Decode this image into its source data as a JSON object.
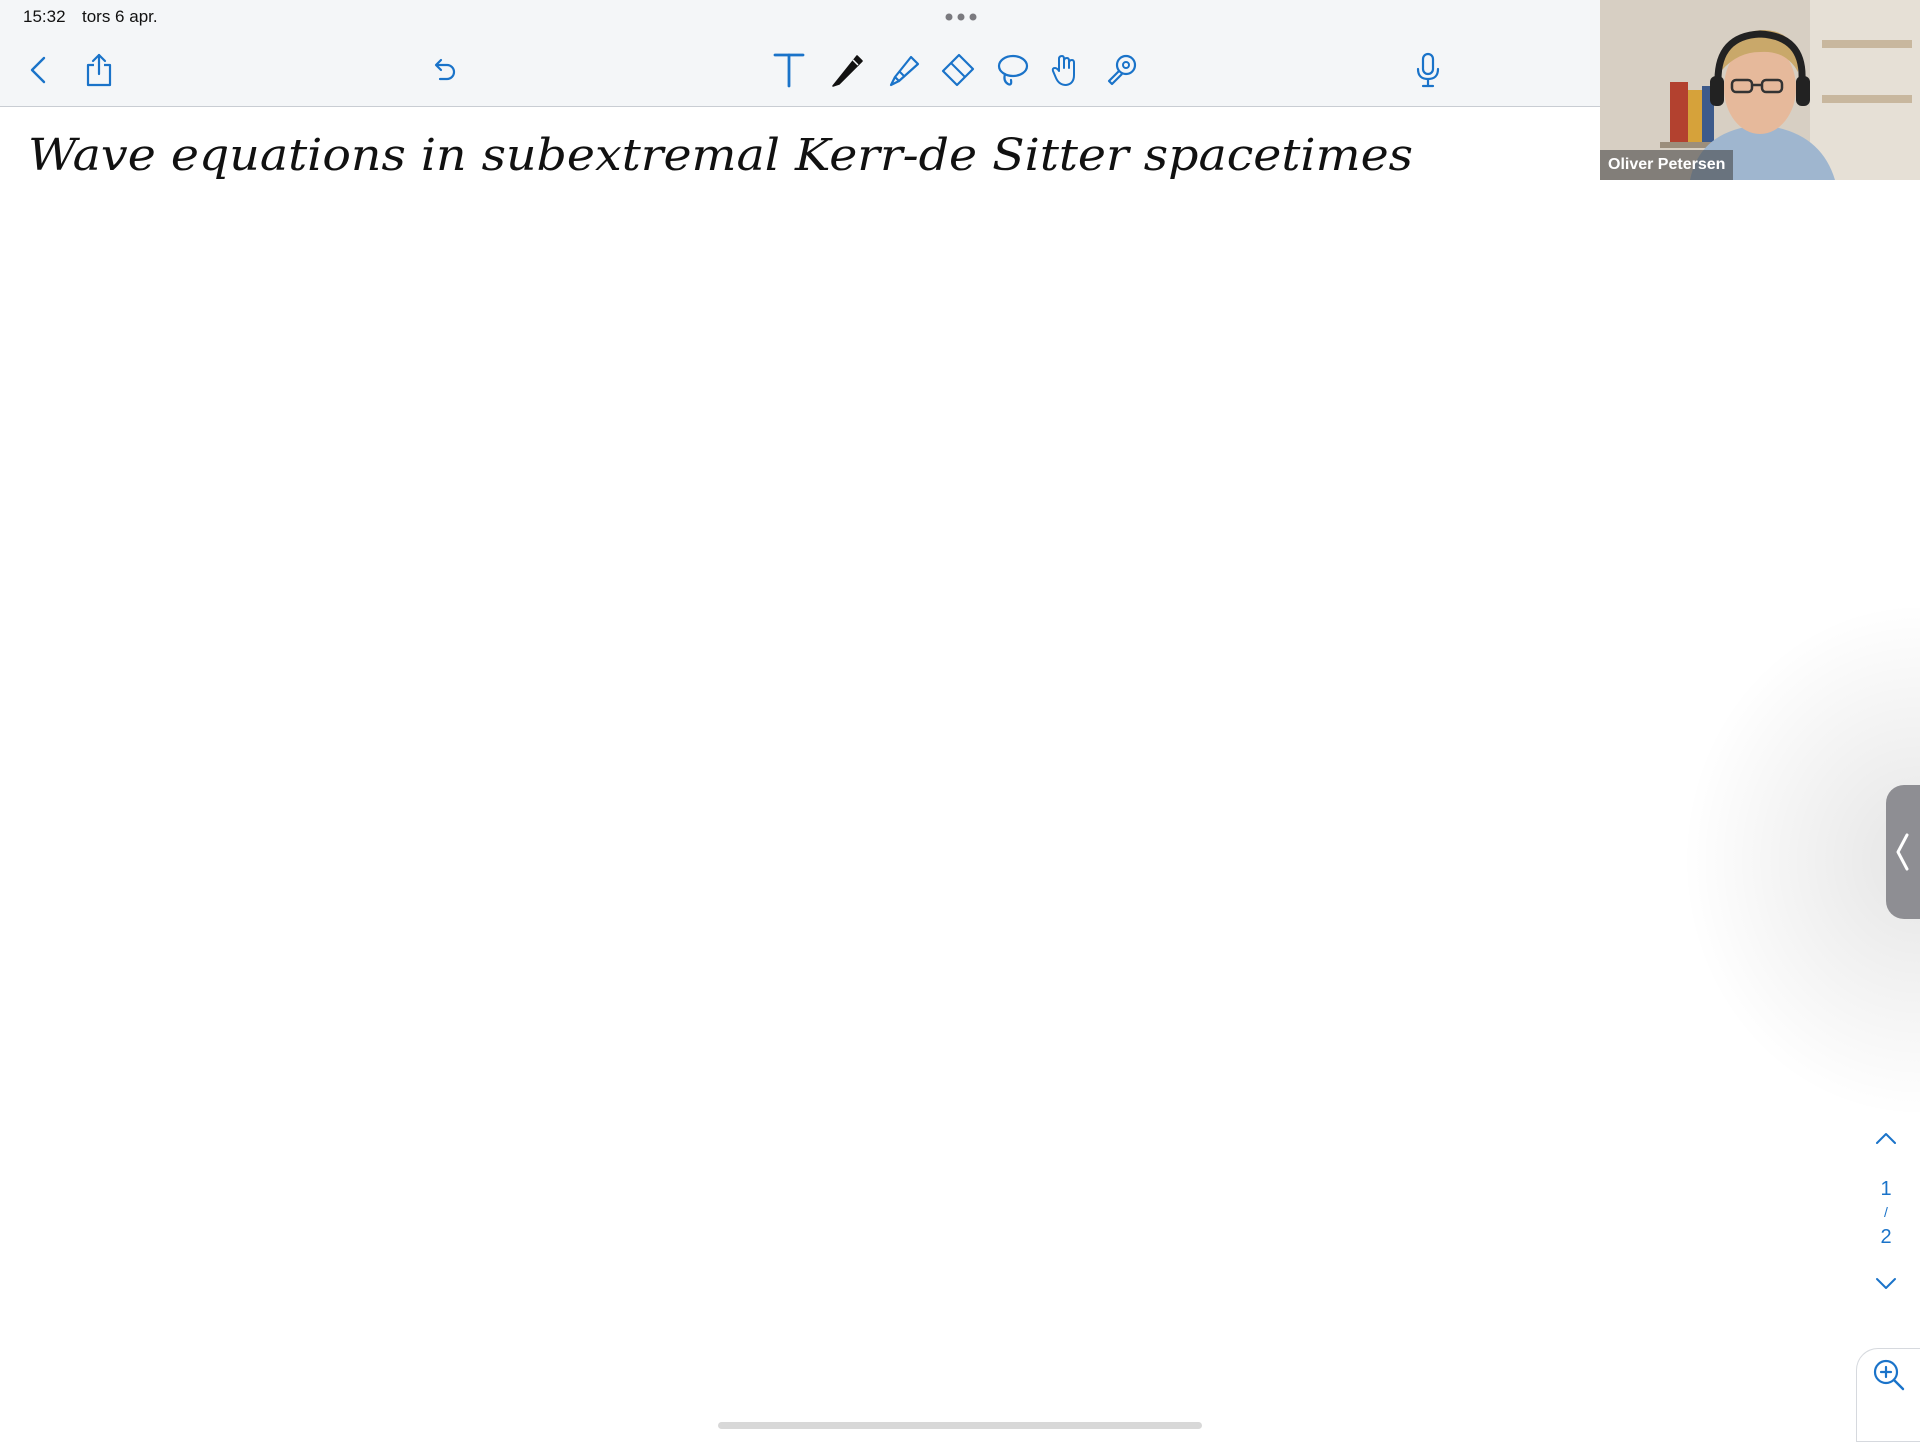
{
  "status": {
    "time": "15:32",
    "date": "tors 6 apr."
  },
  "toolbar": {
    "back_icon": "chevron-left-icon",
    "share_icon": "share-icon",
    "undo_icon": "undo-icon",
    "tools": [
      "text-tool-icon",
      "pen-icon",
      "highlighter-icon",
      "eraser-icon",
      "lasso-icon",
      "hand-icon",
      "laser-pointer-icon"
    ],
    "mic_icon": "microphone-icon",
    "accent_color": "#1a73c9"
  },
  "note": {
    "title": "Wave equations in subextremal Kerr-de Sitter spacetimes"
  },
  "video": {
    "participant_name": "Oliver Petersen"
  },
  "pager": {
    "current": "1",
    "separator": "/",
    "total": "2"
  }
}
